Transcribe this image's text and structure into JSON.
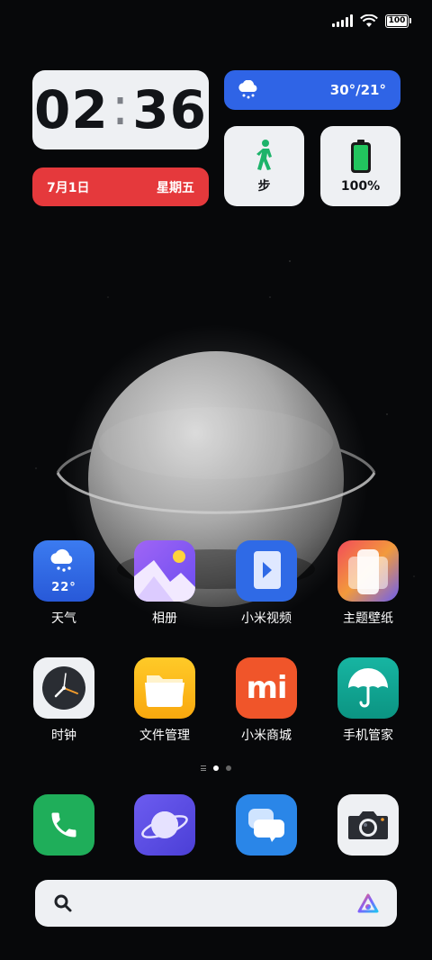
{
  "status": {
    "battery": "100"
  },
  "clock": {
    "hours": "02",
    "minutes": "36"
  },
  "date_widget": {
    "date": "7月1日",
    "weekday": "星期五"
  },
  "weather_widget": {
    "temp_range": "30°/21°"
  },
  "steps_widget": {
    "label": "步"
  },
  "battery_widget": {
    "level": "100%"
  },
  "apps_row1": [
    {
      "label": "天气",
      "icon": "weather-icon",
      "temp": "22°"
    },
    {
      "label": "相册",
      "icon": "gallery-icon"
    },
    {
      "label": "小米视频",
      "icon": "video-icon"
    },
    {
      "label": "主题壁纸",
      "icon": "themes-icon"
    }
  ],
  "apps_row2": [
    {
      "label": "时钟",
      "icon": "clock-icon"
    },
    {
      "label": "文件管理",
      "icon": "folder-icon"
    },
    {
      "label": "小米商城",
      "icon": "mi-store-icon",
      "logo_text": "mi"
    },
    {
      "label": "手机管家",
      "icon": "umbrella-icon"
    }
  ],
  "dock": [
    {
      "icon": "phone-icon"
    },
    {
      "icon": "browser-icon"
    },
    {
      "icon": "messages-icon"
    },
    {
      "icon": "camera-icon"
    }
  ],
  "colors": {
    "date_bg": "#e5393c",
    "weather_bg": "#2f64e6",
    "steps_green": "#1db36a",
    "battery_green": "#22c55e"
  }
}
